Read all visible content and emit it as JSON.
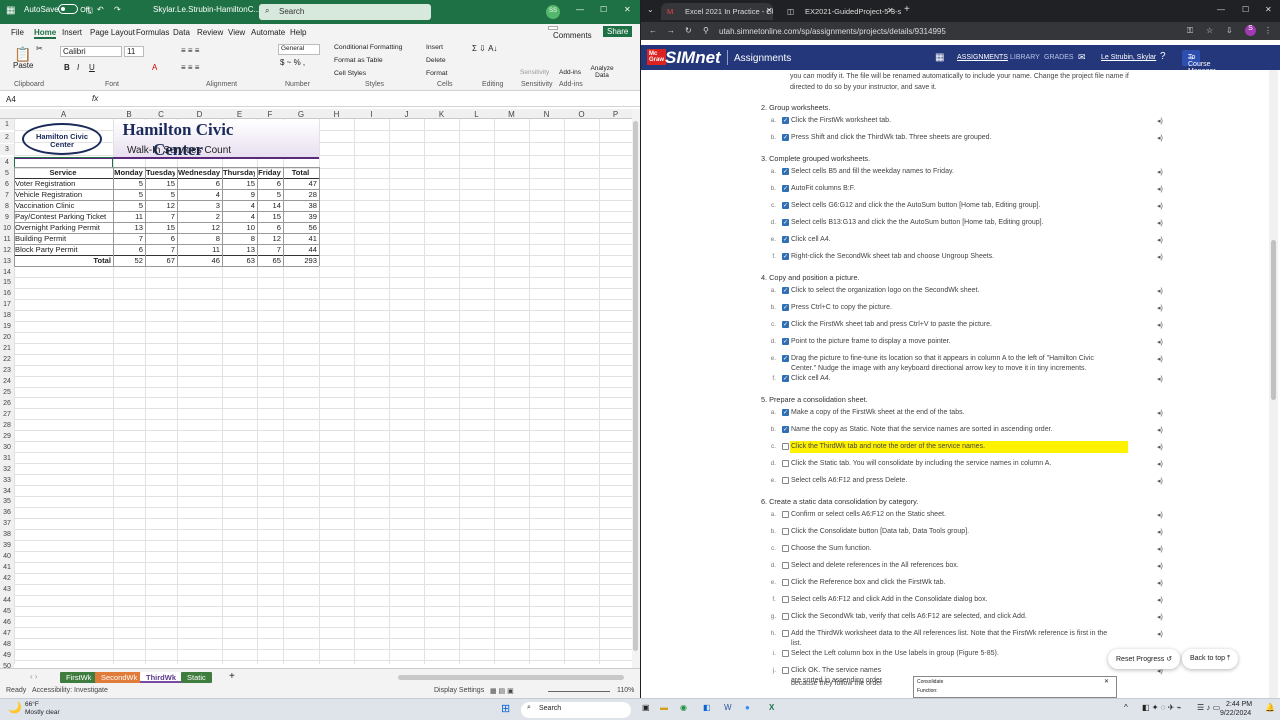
{
  "excel": {
    "autosave_label": "AutoSave",
    "autosave_state": "Off",
    "file_name": "Skylar.Le.Strubin-HamiltonC...",
    "search_placeholder": "Search",
    "user_initials": "SS",
    "menu": [
      "File",
      "Home",
      "Insert",
      "Page Layout",
      "Formulas",
      "Data",
      "Review",
      "View",
      "Automate",
      "Help"
    ],
    "comments_label": "Comments",
    "share_label": "Share",
    "ribbon": {
      "paste": "Paste",
      "font_name": "Calibri",
      "font_size": "11",
      "number_format": "General",
      "cond_format": "Conditional Formatting",
      "format_table": "Format as Table",
      "cell_styles": "Cell Styles",
      "insert": "Insert",
      "delete": "Delete",
      "format": "Format",
      "sensitivity": "Sensitivity",
      "addins": "Add-ins",
      "analyze": "Analyze Data",
      "groups": [
        "Clipboard",
        "Font",
        "Alignment",
        "Number",
        "Styles",
        "Cells",
        "Editing",
        "Sensitivity",
        "Add-ins"
      ]
    },
    "name_box": "A4",
    "fx": "fx",
    "columns": [
      "A",
      "B",
      "C",
      "D",
      "E",
      "F",
      "G",
      "H",
      "I",
      "J",
      "K",
      "L",
      "M",
      "N",
      "O",
      "P"
    ],
    "org_logo_text": "Hamilton Civic Center",
    "title": "Hamilton Civic Center",
    "subtitle": "Walk-In Services Count",
    "table": {
      "headers": [
        "Service",
        "Monday",
        "Tuesday",
        "Wednesday",
        "Thursday",
        "Friday",
        "Total"
      ],
      "rows": [
        [
          "Voter Registration",
          "5",
          "15",
          "6",
          "15",
          "6",
          "47"
        ],
        [
          "Vehicle Registration",
          "5",
          "5",
          "4",
          "9",
          "5",
          "28"
        ],
        [
          "Vaccination Clinic",
          "5",
          "12",
          "3",
          "4",
          "14",
          "38"
        ],
        [
          "Pay/Contest Parking Ticket",
          "11",
          "7",
          "2",
          "4",
          "15",
          "39"
        ],
        [
          "Overnight Parking Permit",
          "13",
          "15",
          "12",
          "10",
          "6",
          "56"
        ],
        [
          "Building Permit",
          "7",
          "6",
          "8",
          "8",
          "12",
          "41"
        ],
        [
          "Block Party Permit",
          "6",
          "7",
          "11",
          "13",
          "7",
          "44"
        ]
      ],
      "total_label": "Total",
      "totals": [
        "52",
        "67",
        "46",
        "63",
        "65",
        "293"
      ]
    },
    "sheet_tabs": [
      "FirstWk",
      "SecondWk",
      "ThirdWk",
      "Static"
    ],
    "status_ready": "Ready",
    "accessibility": "Accessibility: Investigate",
    "display_settings": "Display Settings",
    "zoom": "110%"
  },
  "browser": {
    "tabs": [
      "Excel 2021 In Practice - Ch 5 Gu",
      "EX2021-GuidedProject-5-3-sol"
    ],
    "url": "utah.simnetonline.com/sp/assignments/projects/details/9314995",
    "brand": "SIMnet",
    "section": "Assignments",
    "nav": [
      "ASSIGNMENTS",
      "LIBRARY",
      "GRADES"
    ],
    "user": "Le Strubin, Skylar",
    "course_btn": "To Course Manager",
    "intro": "you can modify it. The file will be renamed automatically to include your name. Change the project file name if",
    "intro2": "directed to do so by your instructor, and save it.",
    "steps": [
      {
        "title": "2. Group worksheets.",
        "items": [
          [
            "a.",
            "Click the FirstWk worksheet tab.",
            true
          ],
          [
            "b.",
            "Press Shift and click the ThirdWk tab. Three sheets are grouped.",
            true
          ]
        ]
      },
      {
        "title": "3. Complete grouped worksheets.",
        "items": [
          [
            "a.",
            "Select cells B5 and fill the weekday names to Friday.",
            true
          ],
          [
            "b.",
            "AutoFit columns B:F.",
            true
          ],
          [
            "c.",
            "Select cells G6:G12 and click the the AutoSum button [Home tab, Editing group].",
            true
          ],
          [
            "d.",
            "Select cells B13:G13 and click the the AutoSum button [Home tab, Editing group].",
            true
          ],
          [
            "e.",
            "Click cell A4.",
            true
          ],
          [
            "f.",
            "Right-click the SecondWk sheet tab and choose Ungroup Sheets.",
            true
          ]
        ]
      },
      {
        "title": "4. Copy and position a picture.",
        "items": [
          [
            "a.",
            "Click to select the organization logo on the SecondWk sheet.",
            true
          ],
          [
            "b.",
            "Press Ctrl+C to copy the picture.",
            true
          ],
          [
            "c.",
            "Click the FirstWk sheet tab and press Ctrl+V to paste the picture.",
            true
          ],
          [
            "d.",
            "Point to the picture frame to display a move pointer.",
            true
          ],
          [
            "e.",
            "Drag the picture to fine-tune its location so that it appears in column A to the left of \"Hamilton Civic",
            true
          ],
          [
            "",
            "Center.\" Nudge the image with any keyboard directional arrow key to move it in tiny increments.",
            null
          ],
          [
            "f.",
            "Click cell A4.",
            true
          ]
        ]
      },
      {
        "title": "5. Prepare a consolidation sheet.",
        "items": [
          [
            "a.",
            "Make a copy of the FirstWk sheet at the end of the tabs.",
            true
          ],
          [
            "b.",
            "Name the copy as Static. Note that the service names are sorted in ascending order.",
            true
          ],
          [
            "c.",
            "Click the ThirdWk tab and note the order of the service names.",
            false
          ],
          [
            "d.",
            "Click the Static tab. You will consolidate by including the service names in column A.",
            false
          ],
          [
            "e.",
            "Select cells A6:F12 and press Delete.",
            false
          ]
        ]
      },
      {
        "title": "6. Create a static data consolidation by category.",
        "items": [
          [
            "a.",
            "Confirm or select cells A6:F12 on the Static sheet.",
            false
          ],
          [
            "b.",
            "Click the Consolidate button [Data tab, Data Tools group].",
            false
          ],
          [
            "c.",
            "Choose the Sum function.",
            false
          ],
          [
            "d.",
            "Select and delete references in the All references box.",
            false
          ],
          [
            "e.",
            "Click the Reference box and click the FirstWk tab.",
            false
          ],
          [
            "f.",
            "Select cells A6:F12 and click Add in the Consolidate dialog box.",
            false
          ],
          [
            "g.",
            "Click the SecondWk tab, verify that cells A6:F12 are selected, and click Add.",
            false
          ],
          [
            "h.",
            "Add the ThirdWk worksheet data to the All references list. Note that the FirstWk reference is first in the",
            false
          ],
          [
            "",
            "list.",
            null
          ],
          [
            "i.",
            "Select the Left column box in the Use labels in group (Figure 5-85).",
            false
          ],
          [
            "j.",
            "Click OK. The service names",
            false
          ],
          [
            "",
            "are sorted in ascending order",
            null
          ],
          [
            "",
            "because they follow the order",
            null
          ]
        ]
      }
    ],
    "reset_progress": "Reset Progress",
    "back_to_top": "Back to top",
    "dialog_title": "Consolidate",
    "dialog_sub": "Function:"
  },
  "taskbar": {
    "temp": "66°F",
    "weather": "Mostly clear",
    "search": "Search",
    "time": "2:44 PM",
    "date": "9/22/2024"
  }
}
